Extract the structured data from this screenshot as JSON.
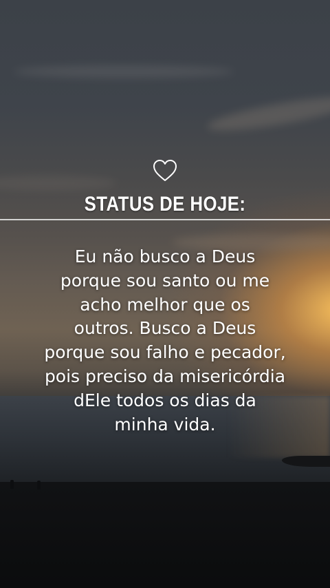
{
  "status": {
    "title": "STATUS DE HOJE:",
    "icon": "heart-outline-icon",
    "quote_lines": [
      "Eu não busco a Deus",
      "porque sou santo ou me",
      "acho melhor que os",
      "outros. Busco a Deus",
      "porque sou falho e pecador,",
      "pois preciso da misericórdia",
      "dEle todos os dias da",
      "minha vida."
    ]
  },
  "colors": {
    "text": "#ffffff",
    "divider": "#ebebeb"
  }
}
